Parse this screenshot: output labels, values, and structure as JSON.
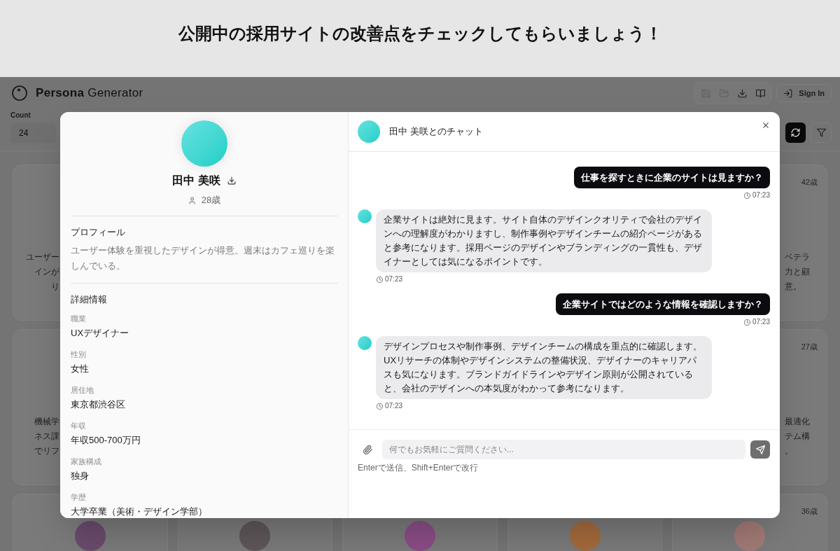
{
  "banner": {
    "title": "公開中の採用サイトの改善点をチェックしてもらいましょう！"
  },
  "app": {
    "brand": "**Persona** Generator",
    "toolbar": [
      {
        "kind": "save",
        "disabled": true
      },
      {
        "kind": "open",
        "disabled": true
      },
      {
        "kind": "download",
        "disabled": false
      },
      {
        "kind": "guide",
        "disabled": false
      }
    ],
    "sign_in": "Sign In",
    "count": {
      "label": "Count",
      "value": "24"
    },
    "card_rows": [
      {
        "cards": [
          {
            "lines": [
              "ユーザー",
              "インが",
              "り"
            ]
          },
          {
            "age": "42歳",
            "lines": [
              "ベテラ",
              "力と顧",
              "意。"
            ]
          }
        ]
      },
      {
        "cards": [
          {
            "lines": [
              "機械学",
              "ネス課",
              "でリフ"
            ]
          },
          {
            "age": "27歳",
            "lines": [
              "最適化",
              "テム構",
              "。"
            ]
          }
        ]
      },
      {
        "cards": [
          {
            "color": "#6a4a6c"
          },
          {
            "color": "#5e5658"
          },
          {
            "color": "#8a4d86"
          },
          {
            "color": "#a36a3c"
          },
          {
            "color": "#a27a76",
            "age": "36歳"
          }
        ]
      }
    ]
  },
  "modal": {
    "persona": {
      "name": "田中 美咲",
      "age": "28歳",
      "profile_heading": "プロフィール",
      "profile": "ユーザー体験を重視したデザインが得意。週末はカフェ巡りを楽しんでいる。",
      "details_heading": "詳細情報",
      "details": [
        {
          "label": "職業",
          "value": "UXデザイナー"
        },
        {
          "label": "性別",
          "value": "女性"
        },
        {
          "label": "居住地",
          "value": "東京都渋谷区"
        },
        {
          "label": "年収",
          "value": "年収500-700万円"
        },
        {
          "label": "家族構成",
          "value": "独身"
        },
        {
          "label": "学歴",
          "value": "大学卒業（美術・デザイン学部）"
        }
      ]
    },
    "chat": {
      "title": "田中 美咲とのチャット",
      "messages": [
        {
          "kind": "user",
          "text": "仕事を探すときに企業のサイトは見ますか？",
          "time": "07:23"
        },
        {
          "kind": "assistant",
          "text": "企業サイトは絶対に見ます。サイト自体のデザインクオリティで会社のデザインへの理解度がわかりますし、制作事例やデザインチームの紹介ページがあると参考になります。採用ページのデザインやブランディングの一貫性も、デザイナーとしては気になるポイントです。",
          "time": "07:23"
        },
        {
          "kind": "user",
          "text": "企業サイトではどのような情報を確認しますか？",
          "time": "07:23"
        },
        {
          "kind": "assistant",
          "text": "デザインプロセスや制作事例、デザインチームの構成を重点的に確認します。UXリサーチの体制やデザインシステムの整備状況、デザイナーのキャリアパスも気になります。ブランドガイドラインやデザイン原則が公開されていると、会社のデザインへの本気度がわかって参考になります。",
          "time": "07:23"
        }
      ],
      "input": {
        "placeholder": "何でもお気軽にご質問ください..."
      },
      "hint": "Enterで送信、Shift+Enterで改行"
    }
  }
}
